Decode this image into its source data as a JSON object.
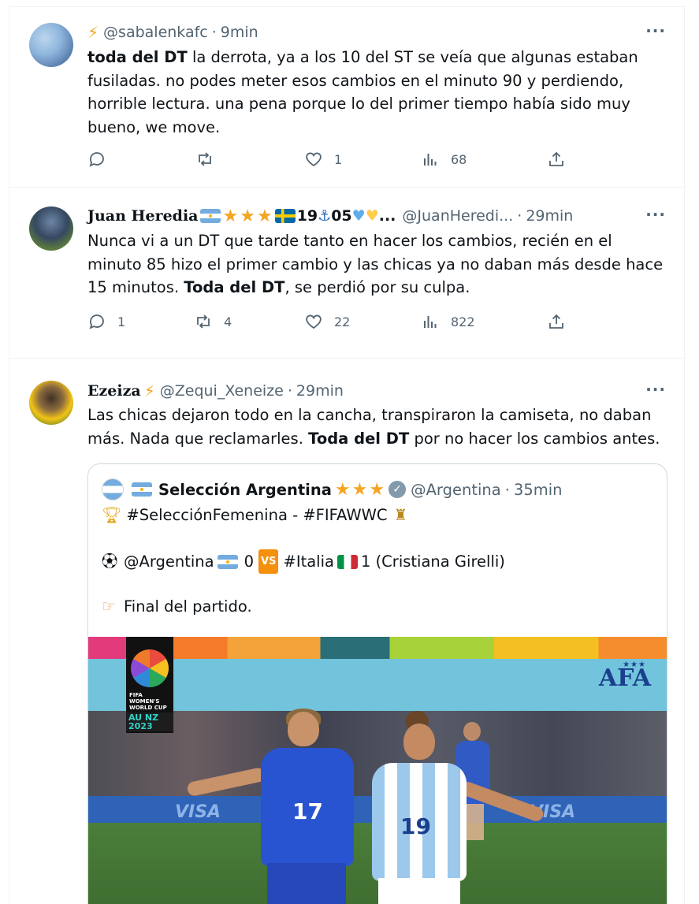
{
  "tweets": [
    {
      "name": "⚡",
      "handle": "@sabalenkafc",
      "time": "9min",
      "text_bold": "toda del DT",
      "text_rest": " la derrota, ya a los 10 del ST se veía que algunas estaban fusiladas. no podes meter esos cambios en el minuto 90 y perdiendo, horrible lectura. una pena porque lo del primer tiempo había sido muy bueno, we move.",
      "replies": "",
      "retweets": "",
      "likes": "1",
      "views": "68"
    },
    {
      "name": "Juan Heredia",
      "name_suffix_1": "19",
      "name_suffix_2": "05",
      "name_ellipsis": "...",
      "handle": "@JuanHeredi...",
      "time": "29min",
      "text_a": "Nunca vi a un DT que tarde tanto en hacer los cambios, recién en el minuto 85 hizo el primer cambio y las chicas ya no daban más desde hace 15 minutos. ",
      "text_bold": "Toda del DT",
      "text_b": ", se perdió por su culpa.",
      "replies": "1",
      "retweets": "4",
      "likes": "22",
      "views": "822"
    },
    {
      "name": "Ezeiza",
      "handle": "@Zequi_Xeneize",
      "time": "29min",
      "text_a": "Las chicas dejaron todo en la cancha, transpiraron la camiseta, no daban más. Nada que reclamarles. ",
      "text_bold": "Toda del DT",
      "text_b": " por no hacer los cambios antes."
    }
  ],
  "quote": {
    "name": "Selección Argentina",
    "handle": "@Argentina",
    "time": "35min",
    "line1": "#SelecciónFemenina - #FIFAWWC",
    "line2_a": "@Argentina",
    "line2_score_a": "0",
    "line2_vs": "VS",
    "line2_b": "#Italia",
    "line2_c": "1 (Cristiana Girelli)",
    "line3": "Final del partido.",
    "media": {
      "wwc_text": "FIFA WOMEN'S WORLD CUP",
      "aunz": "AU NZ 2023",
      "afa": "AFA",
      "afa_stars": "★★★",
      "board": "VISA",
      "num_italy": "17",
      "num_argentina": "19"
    }
  },
  "icons": {
    "bolt": "lightning-icon",
    "more": "more-icon",
    "reply": "reply-icon",
    "retweet": "retweet-icon",
    "like": "heart-icon",
    "views": "views-icon",
    "share": "share-icon"
  },
  "ui": {
    "more_glyph": "···",
    "dot": "·"
  },
  "colors": {
    "text": "#0f1419",
    "secondary": "#536471",
    "border": "#eff3f4",
    "star": "#f4a623"
  }
}
